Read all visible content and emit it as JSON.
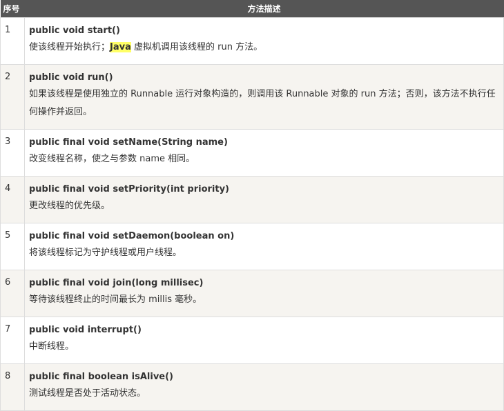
{
  "table": {
    "header": {
      "col_num": "序号",
      "col_desc": "方法描述"
    },
    "rows": [
      {
        "num": "1",
        "signature": "public void start()",
        "desc_pre": "使该线程开始执行；",
        "desc_highlight": "Java",
        "desc_post": " 虚拟机调用该线程的 run 方法。"
      },
      {
        "num": "2",
        "signature": "public void run()",
        "desc": "如果该线程是使用独立的 Runnable 运行对象构造的，则调用该 Runnable 对象的 run 方法；否则，该方法不执行任何操作并返回。"
      },
      {
        "num": "3",
        "signature": "public final void setName(String name)",
        "desc": "改变线程名称，使之与参数 name 相同。"
      },
      {
        "num": "4",
        "signature": "public final void setPriority(int priority)",
        "desc": " 更改线程的优先级。"
      },
      {
        "num": "5",
        "signature": "public final void setDaemon(boolean on)",
        "desc": "将该线程标记为守护线程或用户线程。"
      },
      {
        "num": "6",
        "signature": "public final void join(long millisec)",
        "desc": "等待该线程终止的时间最长为 millis 毫秒。"
      },
      {
        "num": "7",
        "signature": "public void interrupt()",
        "desc": "中断线程。"
      },
      {
        "num": "8",
        "signature": "public final boolean isAlive()",
        "desc": "测试线程是否处于活动状态。"
      }
    ]
  },
  "colors": {
    "header_bg": "#555555",
    "row_alt_bg": "#f6f4f0",
    "highlight": "#ffff66"
  }
}
